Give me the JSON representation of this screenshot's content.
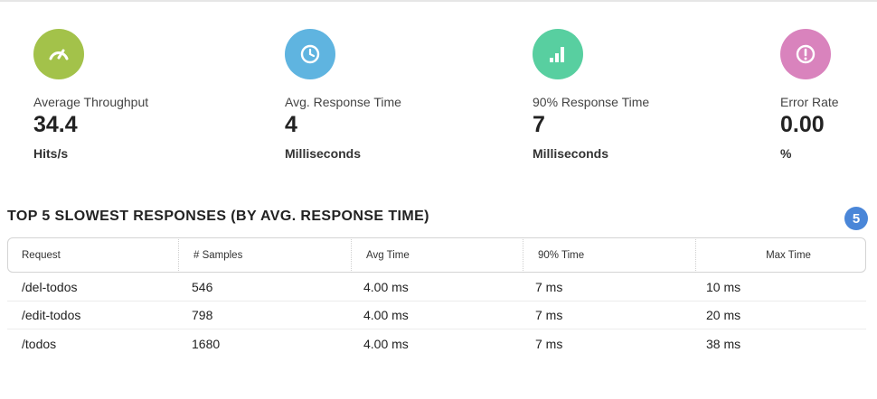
{
  "metrics": [
    {
      "label": "Average Throughput",
      "value": "34.4",
      "unit": "Hits/s",
      "color": "#a3c24a",
      "icon": "speedometer-icon"
    },
    {
      "label": "Avg. Response Time",
      "value": "4",
      "unit": "Milliseconds",
      "color": "#5fb4e0",
      "icon": "clock-icon"
    },
    {
      "label": "90% Response Time",
      "value": "7",
      "unit": "Milliseconds",
      "color": "#58cfa0",
      "icon": "bar-chart-icon"
    },
    {
      "label": "Error Rate",
      "value": "0.00",
      "unit": "%",
      "color": "#d983bd",
      "icon": "exclamation-icon"
    }
  ],
  "slowest": {
    "title": "TOP 5 SLOWEST RESPONSES (BY AVG. RESPONSE TIME)",
    "count": "5",
    "badge_color": "#4a86d8",
    "headers": [
      "Request",
      "# Samples",
      "Avg Time",
      "90% Time",
      "Max Time"
    ],
    "rows": [
      [
        "/del-todos",
        "546",
        "4.00 ms",
        "7 ms",
        "10 ms"
      ],
      [
        "/edit-todos",
        "798",
        "4.00 ms",
        "7 ms",
        "20 ms"
      ],
      [
        "/todos",
        "1680",
        "4.00 ms",
        "7 ms",
        "38 ms"
      ]
    ]
  }
}
